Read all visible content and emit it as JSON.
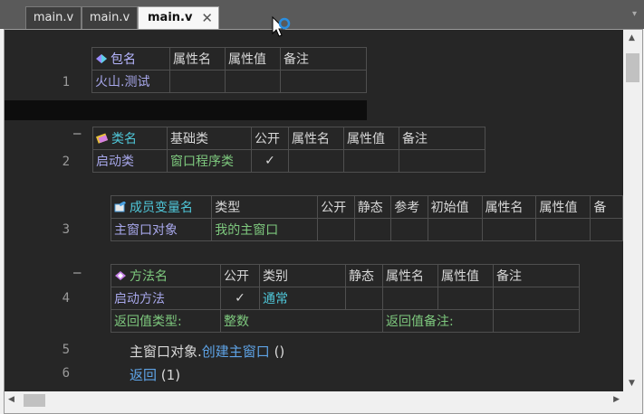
{
  "tabs": [
    {
      "label": "main.v"
    },
    {
      "label": "main.v"
    },
    {
      "label": "main.v",
      "close": "✕"
    }
  ],
  "lines": [
    "1",
    "2",
    "3",
    "4",
    "5",
    "6"
  ],
  "fold": "—",
  "package_table": {
    "headers": [
      "包名",
      "属性名",
      "属性值",
      "备注"
    ],
    "row": [
      "火山.测试",
      "",
      "",
      ""
    ]
  },
  "class_table": {
    "headers": [
      "类名",
      "基础类",
      "公开",
      "属性名",
      "属性值",
      "备注"
    ],
    "row": [
      "启动类",
      "窗口程序类",
      "✓",
      "",
      "",
      ""
    ]
  },
  "member_table": {
    "headers": [
      "成员变量名",
      "类型",
      "公开",
      "静态",
      "参考",
      "初始值",
      "属性名",
      "属性值",
      "备"
    ],
    "row": [
      "主窗口对象",
      "我的主窗口",
      "",
      "",
      "",
      "",
      "",
      "",
      ""
    ]
  },
  "method_table": {
    "headers": [
      "方法名",
      "公开",
      "类别",
      "静态",
      "属性名",
      "属性值",
      "备注"
    ],
    "row": [
      "启动方法",
      "✓",
      "通常",
      "",
      "",
      "",
      ""
    ],
    "return_type_label": "返回值类型:",
    "return_type_value": "整数",
    "return_note_label": "返回值备注:"
  },
  "code": {
    "line5_obj": "主窗口对象.",
    "line5_call": "创建主窗口",
    "line5_args": "()",
    "line6_kw": "返回",
    "line6_args": "(1)"
  },
  "scroll": {
    "up": "▲",
    "down": "▼",
    "left": "◀",
    "right": "▶"
  }
}
